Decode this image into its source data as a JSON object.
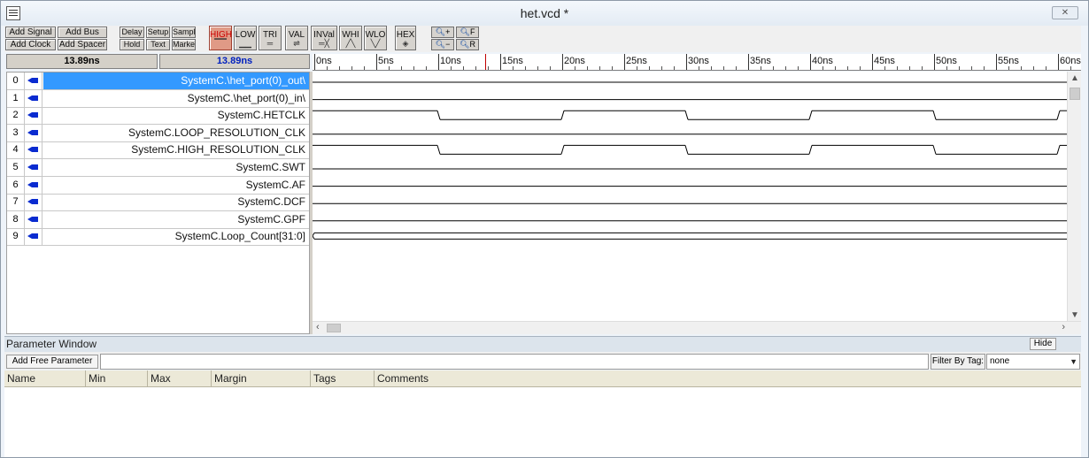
{
  "window": {
    "title": "het.vcd *",
    "close_glyph": "✕"
  },
  "toolbar": {
    "add_signal": "Add Signal",
    "add_bus": "Add Bus",
    "add_clock": "Add Clock",
    "add_spacer": "Add Spacer",
    "delay": "Delay",
    "setup": "Setup",
    "sample": "Sample",
    "hold": "Hold",
    "text": "Text",
    "marker": "Marker",
    "wave_buttons": [
      "HIGH",
      "LOW",
      "TRI",
      "VAL",
      "INVal",
      "WHI",
      "WLO",
      "HEX"
    ],
    "zoom_in": "+",
    "zoom_full": "F",
    "zoom_out": "−",
    "zoom_reset": "R"
  },
  "time": {
    "cursor_time": "13.89ns",
    "marker_time": "13.89ns",
    "ruler_labels": [
      "0ns",
      "5ns",
      "10ns",
      "15ns",
      "20ns",
      "25ns",
      "30ns",
      "35ns",
      "40ns",
      "45ns",
      "50ns",
      "55ns",
      "60ns"
    ]
  },
  "signals": [
    {
      "index": "0",
      "name": "SystemC.\\het_port(0)_out\\",
      "selected": true
    },
    {
      "index": "1",
      "name": "SystemC.\\het_port(0)_in\\"
    },
    {
      "index": "2",
      "name": "SystemC.HETCLK"
    },
    {
      "index": "3",
      "name": "SystemC.LOOP_RESOLUTION_CLK"
    },
    {
      "index": "4",
      "name": "SystemC.HIGH_RESOLUTION_CLK"
    },
    {
      "index": "5",
      "name": "SystemC.SWT"
    },
    {
      "index": "6",
      "name": "SystemC.AF"
    },
    {
      "index": "7",
      "name": "SystemC.DCF"
    },
    {
      "index": "8",
      "name": "SystemC.GPF"
    },
    {
      "index": "9",
      "name": "SystemC.Loop_Count[31:0]"
    }
  ],
  "param_window": {
    "title": "Parameter Window",
    "hide_label": "Hide",
    "add_free_parameter": "Add Free Parameter",
    "filter_label": "Filter By Tag:",
    "filter_value": "none",
    "columns": [
      "Name",
      "Min",
      "Max",
      "Margin",
      "Tags",
      "Comments"
    ]
  }
}
